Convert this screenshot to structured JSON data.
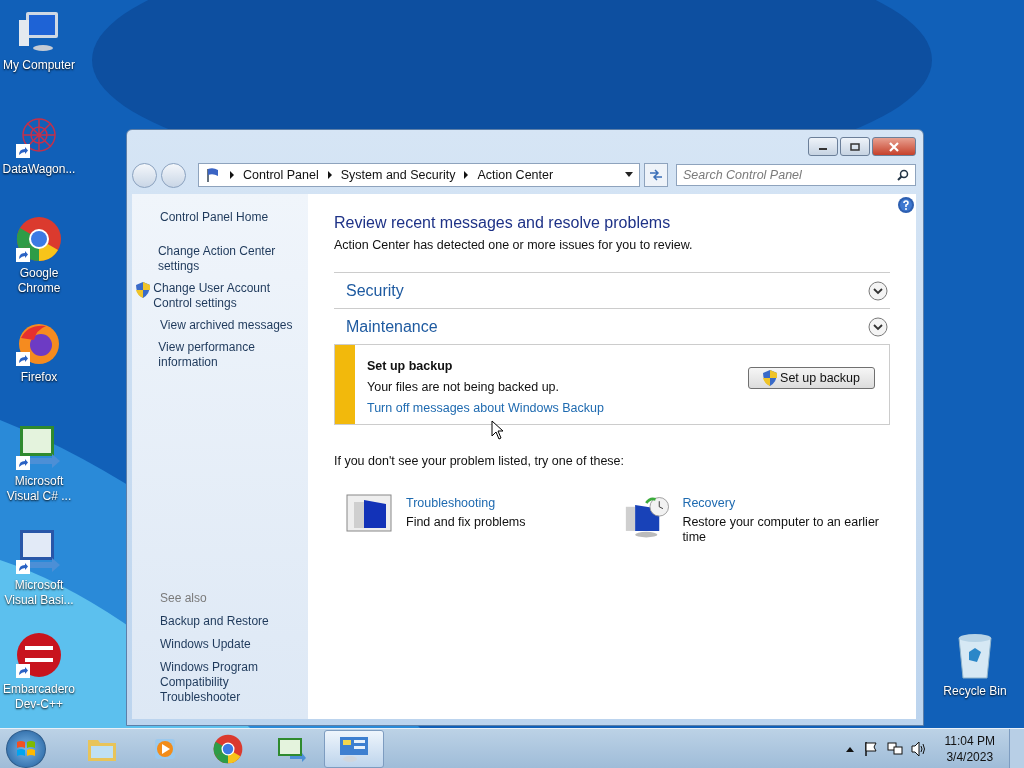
{
  "desktop_icons": [
    {
      "label": "My Computer",
      "kind": "computer",
      "shortcut": false
    },
    {
      "label": "DataWagon...",
      "kind": "datawagon",
      "shortcut": true
    },
    {
      "label": "Google Chrome",
      "kind": "chrome",
      "shortcut": true
    },
    {
      "label": "Firefox",
      "kind": "firefox",
      "shortcut": true
    },
    {
      "label": "Microsoft Visual C# ...",
      "kind": "csharp",
      "shortcut": true
    },
    {
      "label": "Microsoft Visual Basi...",
      "kind": "vb",
      "shortcut": true
    },
    {
      "label": "Embarcadero Dev-C++",
      "kind": "devcpp",
      "shortcut": true
    }
  ],
  "recycle_bin": {
    "label": "Recycle Bin"
  },
  "window": {
    "address": [
      "Control Panel",
      "System and Security",
      "Action Center"
    ],
    "search": {
      "placeholder": "Search Control Panel"
    },
    "sidebar": {
      "tasks": [
        {
          "label": "Control Panel Home",
          "shield": false
        },
        {
          "label": "Change Action Center settings",
          "shield": false
        },
        {
          "label": "Change User Account Control settings",
          "shield": true
        },
        {
          "label": "View archived messages",
          "shield": false
        },
        {
          "label": "View performance information",
          "shield": false
        }
      ],
      "see_also": {
        "heading": "See also",
        "links": [
          "Backup and Restore",
          "Windows Update",
          "Windows Program Compatibility Troubleshooter"
        ]
      }
    },
    "main": {
      "title": "Review recent messages and resolve problems",
      "subtitle": "Action Center has detected one or more issues for you to review.",
      "sections": [
        {
          "title": "Security"
        },
        {
          "title": "Maintenance"
        }
      ],
      "message": {
        "title": "Set up backup",
        "text": "Your files are not being backed up.",
        "link": "Turn off messages about Windows Backup",
        "button": "Set up backup",
        "color": "#f2b90c"
      },
      "hint": "If you don't see your problem listed, try one of these:",
      "tools": [
        {
          "kind": "troubleshooting",
          "title": "Troubleshooting",
          "description": "Find and fix problems"
        },
        {
          "kind": "recovery",
          "title": "Recovery",
          "description": "Restore your computer to an earlier time"
        }
      ]
    }
  },
  "taskbar": {
    "apps": [
      {
        "kind": "explorer",
        "selected": false
      },
      {
        "kind": "media",
        "selected": false
      },
      {
        "kind": "chrome",
        "selected": false
      },
      {
        "kind": "csharp",
        "selected": false
      },
      {
        "kind": "controlpanel",
        "selected": true
      }
    ],
    "time": "11:04 PM",
    "date": "3/4/2023"
  }
}
